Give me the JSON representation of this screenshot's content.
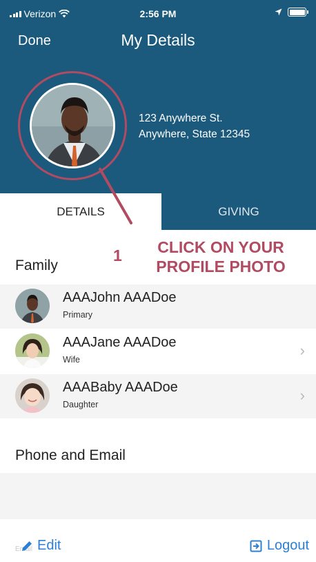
{
  "status_bar": {
    "carrier": "Verizon",
    "time": "2:56 PM"
  },
  "nav": {
    "done_label": "Done",
    "title": "My Details"
  },
  "profile": {
    "address_line1": "123 Anywhere St.",
    "address_line2": "Anywhere, State 12345"
  },
  "tabs": [
    {
      "label": "DETAILS",
      "selected": true
    },
    {
      "label": "GIVING",
      "selected": false
    }
  ],
  "callout": {
    "number": "1",
    "line1": "CLICK ON YOUR",
    "line2": "PROFILE PHOTO"
  },
  "family": {
    "heading": "Family",
    "members": [
      {
        "name": "AAAJohn AAADoe",
        "role": "Primary",
        "has_chevron": false
      },
      {
        "name": "AAAJane AAADoe",
        "role": "Wife",
        "has_chevron": true
      },
      {
        "name": "AAABaby AAADoe",
        "role": "Daughter",
        "has_chevron": true
      }
    ]
  },
  "phone_email": {
    "heading": "Phone and Email"
  },
  "footer": {
    "edit_label": "Edit",
    "logout_label": "Logout",
    "faded_text": "Email"
  },
  "colors": {
    "header_bg": "#1b5a7d",
    "accent_annotation": "#b04b62",
    "link_blue": "#2c7fd6"
  }
}
